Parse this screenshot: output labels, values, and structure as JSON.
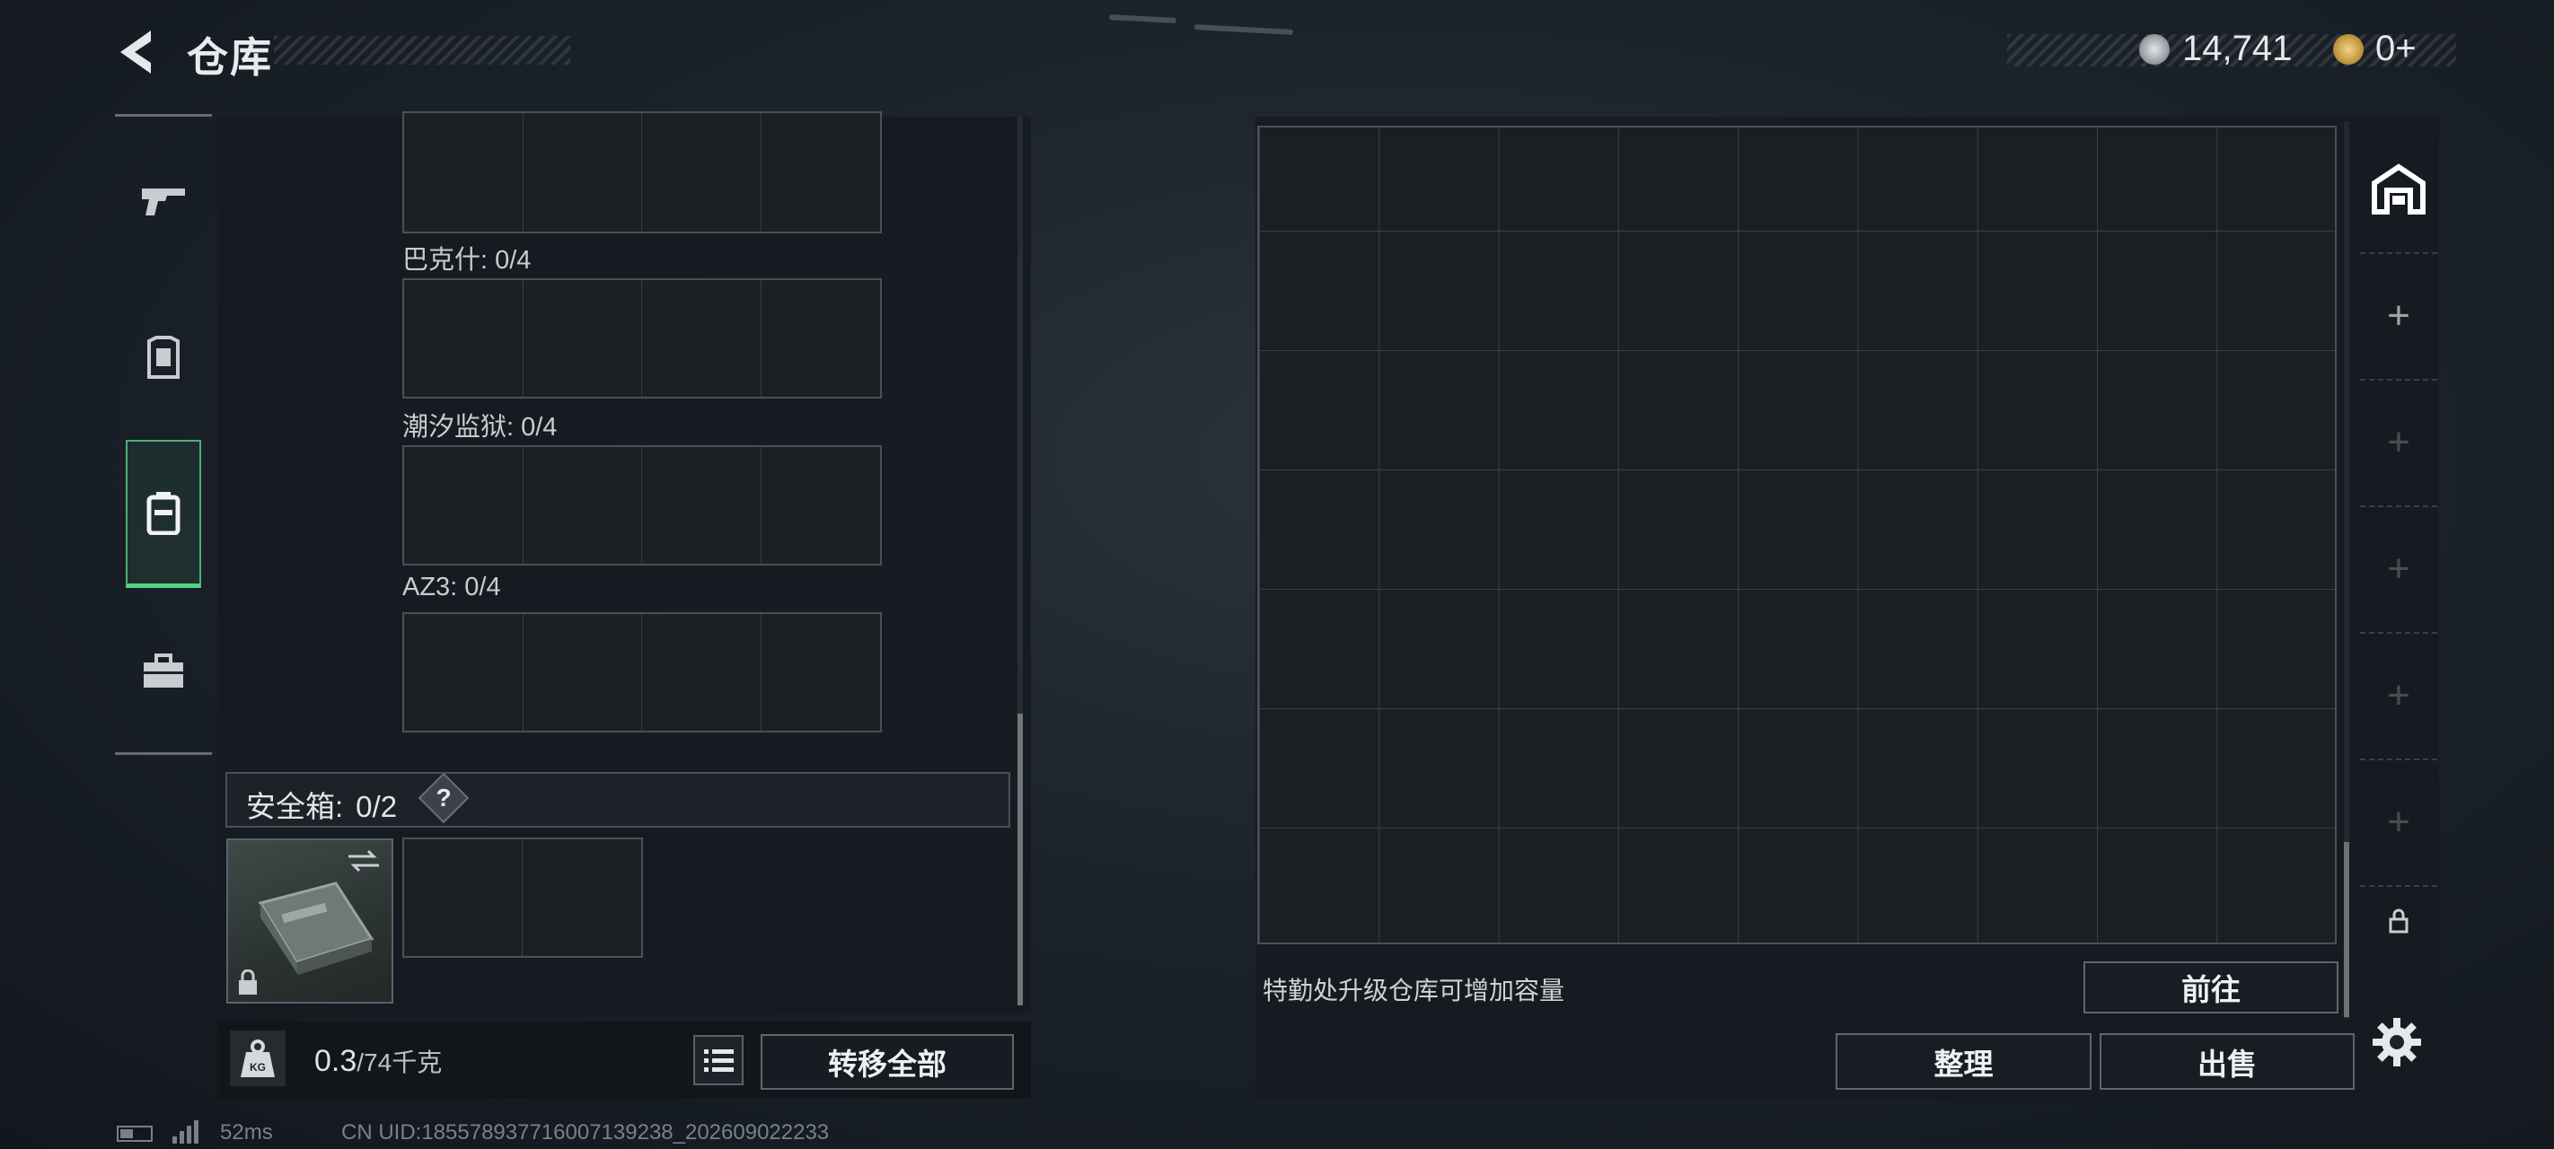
{
  "header": {
    "title": "仓库",
    "currency_primary": "14,741",
    "currency_secondary": "0+"
  },
  "left_panel": {
    "slots": [
      {
        "label": "巴克什: 0/4"
      },
      {
        "label": "潮汐监狱: 0/4"
      },
      {
        "label": "AZ3: 0/4"
      }
    ],
    "safe_box_label": "安全箱:",
    "safe_box_count": "0/2",
    "help_symbol": "?",
    "weight_value": "0.3",
    "weight_capacity": "/74千克",
    "kg_badge": "KG",
    "transfer_all_label": "转移全部"
  },
  "storage": {
    "hint": "特勤处升级仓库可增加容量",
    "goto_label": "前往",
    "sort_label": "整理",
    "sell_label": "出售",
    "tabs": [
      "+",
      "+",
      "+",
      "+",
      "+"
    ]
  },
  "status_bar": {
    "ping": "52ms",
    "uid": "CN UID:18557893771600713923​8_202609022233"
  },
  "icons": {
    "back": "back-arrow-icon",
    "currency1": "coin-icon",
    "currency2": "token-icon",
    "rail": [
      "pistol-icon",
      "armor-icon",
      "backpack-icon",
      "toolbox-icon"
    ],
    "storage_tab": "warehouse-icon",
    "lock": "lock-icon",
    "settings": "gear-icon",
    "list": "list-icon",
    "swap": "swap-icon"
  },
  "colors": {
    "accent_green": "#57d28a",
    "panel": "#161b21"
  }
}
